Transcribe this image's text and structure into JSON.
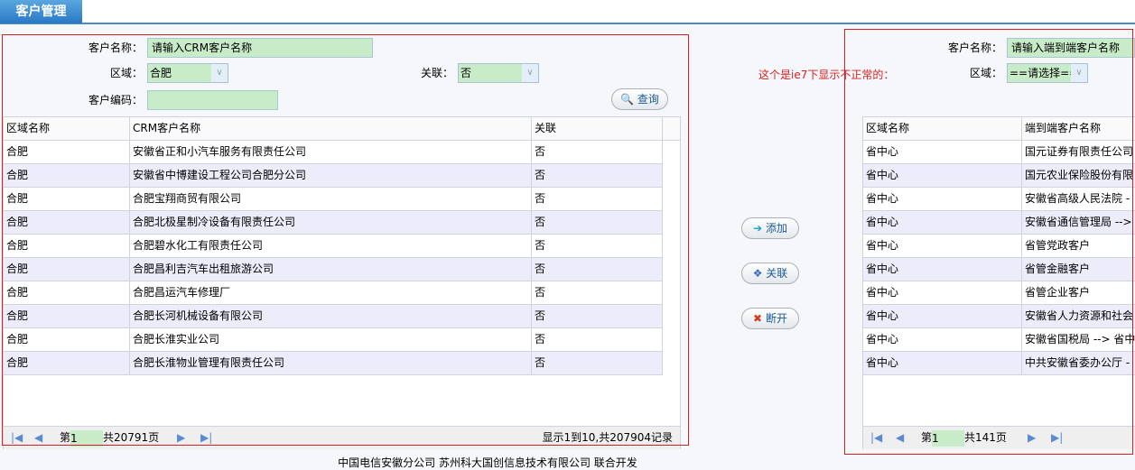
{
  "header": {
    "tab": "客户管理"
  },
  "left": {
    "name_label": "客户名称：",
    "name_value": "请输入CRM客户名称",
    "region_label": "区域：",
    "region_value": "合肥",
    "link_label": "关联：",
    "link_value": "否",
    "code_label": "客户编码：",
    "code_value": "",
    "query_button": "查询",
    "columns": [
      "区域名称",
      "CRM客户名称",
      "关联"
    ],
    "rows": [
      [
        "合肥",
        "安徽省正和小汽车服务有限责任公司",
        "否"
      ],
      [
        "合肥",
        "安徽省中博建设工程公司合肥分公司",
        "否"
      ],
      [
        "合肥",
        "合肥宝翔商贸有限公司",
        "否"
      ],
      [
        "合肥",
        "合肥北极星制冷设备有限责任公司",
        "否"
      ],
      [
        "合肥",
        "合肥碧水化工有限责任公司",
        "否"
      ],
      [
        "合肥",
        "合肥昌利吉汽车出租旅游公司",
        "否"
      ],
      [
        "合肥",
        "合肥昌运汽车修理厂",
        "否"
      ],
      [
        "合肥",
        "合肥长河机械设备有限公司",
        "否"
      ],
      [
        "合肥",
        "合肥长淮实业公司",
        "否"
      ],
      [
        "合肥",
        "合肥长淮物业管理有限责任公司",
        "否"
      ]
    ],
    "pager": {
      "page_prefix": "第",
      "page": "1",
      "total_pages": "共20791页",
      "summary": "显示1到10,共207904记录"
    }
  },
  "middle": {
    "note": "这个是ie7下显示不正常的：",
    "add": "添加",
    "link": "关联",
    "unlink": "断开"
  },
  "right": {
    "name_label": "客户名称：",
    "name_value": "请输入端到端客户名称",
    "region_label": "区域：",
    "region_value": "==请选择==",
    "columns": [
      "区域名称",
      "端到端客户名称"
    ],
    "rows": [
      [
        "省中心",
        "国元证券有限责任公司"
      ],
      [
        "省中心",
        "国元农业保险股份有限"
      ],
      [
        "省中心",
        "安徽省高级人民法院 -"
      ],
      [
        "省中心",
        "安徽省通信管理局 -->"
      ],
      [
        "省中心",
        "省管党政客户"
      ],
      [
        "省中心",
        "省管金融客户"
      ],
      [
        "省中心",
        "省管企业客户"
      ],
      [
        "省中心",
        "安徽省人力资源和社会"
      ],
      [
        "省中心",
        "安徽省国税局 --> 省中"
      ],
      [
        "省中心",
        "中共安徽省委办公厅 -"
      ]
    ],
    "pager": {
      "page_prefix": "第",
      "page": "1",
      "total_pages": "共141页"
    }
  },
  "footer": {
    "text": "中国电信安徽分公司  苏州科大国创信息技术有限公司  联合开发"
  }
}
